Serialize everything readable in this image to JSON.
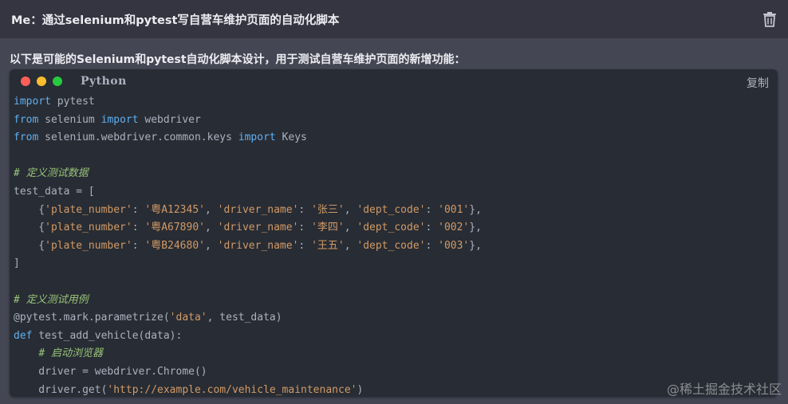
{
  "user_message": {
    "text": "Me：通过selenium和pytest写自营车维护页面的自动化脚本",
    "delete_icon": "trash-icon"
  },
  "assistant": {
    "intro": "以下是可能的Selenium和pytest自动化脚本设计，用于测试自营车维护页面的新增功能："
  },
  "code_block": {
    "language": "Python",
    "copy_label": "复制",
    "window_dots": [
      "#ff5f56",
      "#ffbd2e",
      "#27c93f"
    ],
    "lines": [
      [
        {
          "t": "import",
          "c": "kw"
        },
        {
          "t": " pytest",
          "c": "pl"
        }
      ],
      [
        {
          "t": "from",
          "c": "kw"
        },
        {
          "t": " selenium ",
          "c": "pl"
        },
        {
          "t": "import",
          "c": "kw"
        },
        {
          "t": " webdriver",
          "c": "pl"
        }
      ],
      [
        {
          "t": "from",
          "c": "kw"
        },
        {
          "t": " selenium.webdriver.common.keys ",
          "c": "pl"
        },
        {
          "t": "import",
          "c": "kw"
        },
        {
          "t": " Keys",
          "c": "pl"
        }
      ],
      [],
      [
        {
          "t": "# 定义测试数据",
          "c": "cm"
        }
      ],
      [
        {
          "t": "test_data = [",
          "c": "pl"
        }
      ],
      [
        {
          "t": "    {",
          "c": "pl"
        },
        {
          "t": "'plate_number'",
          "c": "st"
        },
        {
          "t": ": ",
          "c": "pl"
        },
        {
          "t": "'粤A12345'",
          "c": "st"
        },
        {
          "t": ", ",
          "c": "pl"
        },
        {
          "t": "'driver_name'",
          "c": "st"
        },
        {
          "t": ": ",
          "c": "pl"
        },
        {
          "t": "'张三'",
          "c": "st"
        },
        {
          "t": ", ",
          "c": "pl"
        },
        {
          "t": "'dept_code'",
          "c": "st"
        },
        {
          "t": ": ",
          "c": "pl"
        },
        {
          "t": "'001'",
          "c": "st"
        },
        {
          "t": "},",
          "c": "pl"
        }
      ],
      [
        {
          "t": "    {",
          "c": "pl"
        },
        {
          "t": "'plate_number'",
          "c": "st"
        },
        {
          "t": ": ",
          "c": "pl"
        },
        {
          "t": "'粤A67890'",
          "c": "st"
        },
        {
          "t": ", ",
          "c": "pl"
        },
        {
          "t": "'driver_name'",
          "c": "st"
        },
        {
          "t": ": ",
          "c": "pl"
        },
        {
          "t": "'李四'",
          "c": "st"
        },
        {
          "t": ", ",
          "c": "pl"
        },
        {
          "t": "'dept_code'",
          "c": "st"
        },
        {
          "t": ": ",
          "c": "pl"
        },
        {
          "t": "'002'",
          "c": "st"
        },
        {
          "t": "},",
          "c": "pl"
        }
      ],
      [
        {
          "t": "    {",
          "c": "pl"
        },
        {
          "t": "'plate_number'",
          "c": "st"
        },
        {
          "t": ": ",
          "c": "pl"
        },
        {
          "t": "'粤B24680'",
          "c": "st"
        },
        {
          "t": ", ",
          "c": "pl"
        },
        {
          "t": "'driver_name'",
          "c": "st"
        },
        {
          "t": ": ",
          "c": "pl"
        },
        {
          "t": "'王五'",
          "c": "st"
        },
        {
          "t": ", ",
          "c": "pl"
        },
        {
          "t": "'dept_code'",
          "c": "st"
        },
        {
          "t": ": ",
          "c": "pl"
        },
        {
          "t": "'003'",
          "c": "st"
        },
        {
          "t": "},",
          "c": "pl"
        }
      ],
      [
        {
          "t": "]",
          "c": "pl"
        }
      ],
      [],
      [
        {
          "t": "# 定义测试用例",
          "c": "cm"
        }
      ],
      [
        {
          "t": "@pytest.mark.parametrize(",
          "c": "pl"
        },
        {
          "t": "'data'",
          "c": "st"
        },
        {
          "t": ", test_data)",
          "c": "pl"
        }
      ],
      [
        {
          "t": "def",
          "c": "kw"
        },
        {
          "t": " test_add_vehicle(data):",
          "c": "pl"
        }
      ],
      [
        {
          "t": "    ",
          "c": "pl"
        },
        {
          "t": "# 启动浏览器",
          "c": "cm"
        }
      ],
      [
        {
          "t": "    driver = webdriver.Chrome()",
          "c": "pl"
        }
      ],
      [
        {
          "t": "    driver.get(",
          "c": "pl"
        },
        {
          "t": "'http://example.com/vehicle_maintenance'",
          "c": "st"
        },
        {
          "t": ")",
          "c": "pl"
        }
      ]
    ]
  },
  "watermark": "@稀土掘金技术社区"
}
